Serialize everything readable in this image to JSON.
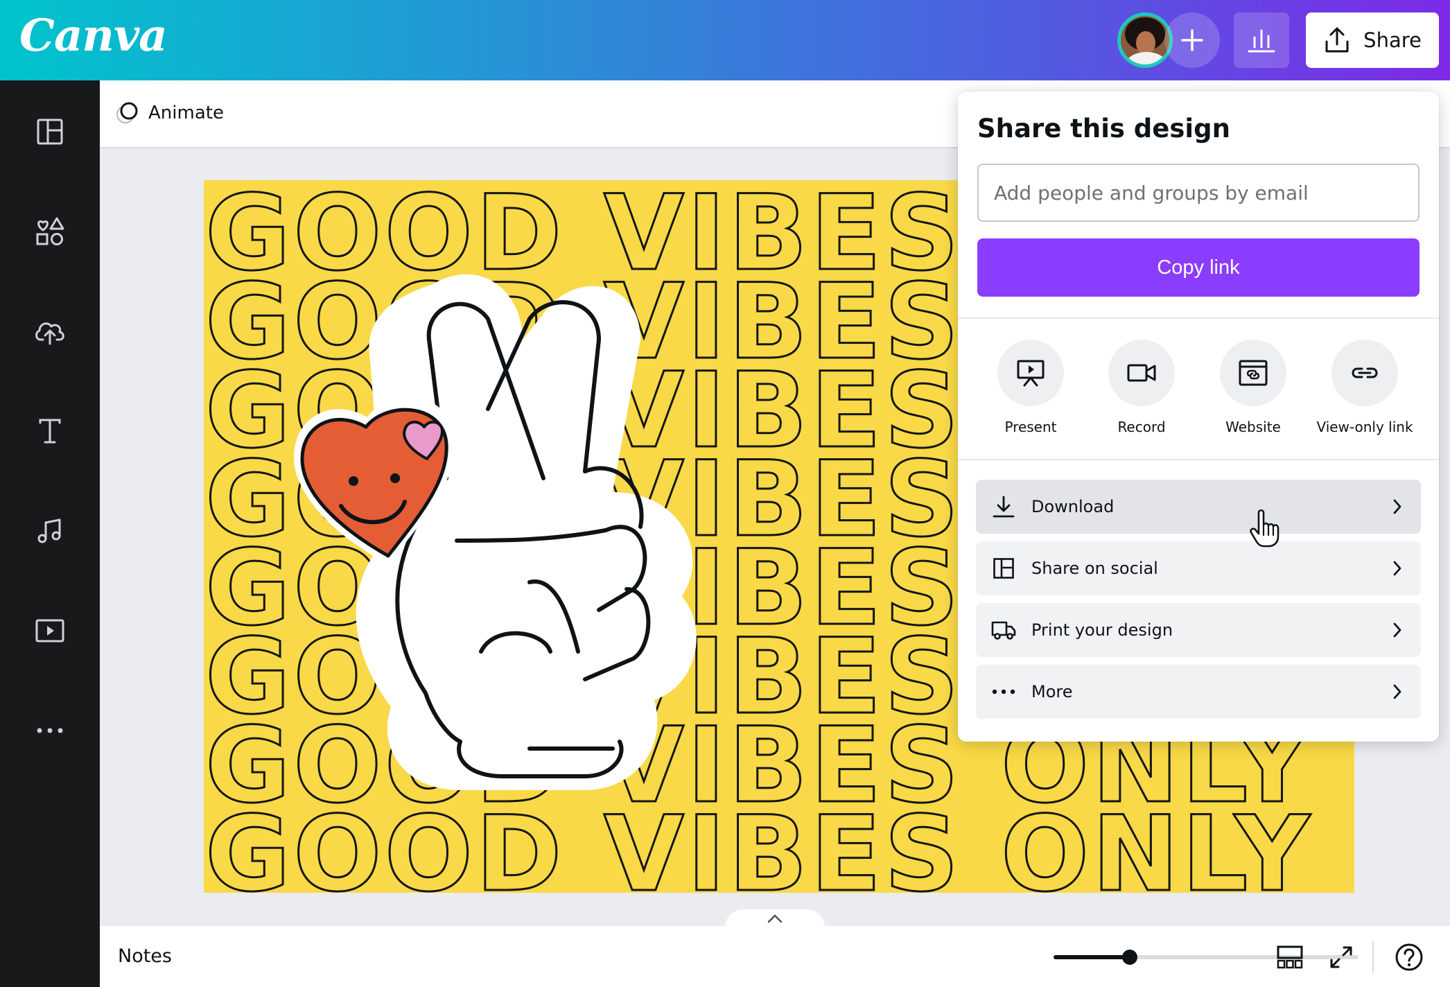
{
  "header": {
    "logo": "Canva",
    "share_label": "Share"
  },
  "toolbar": {
    "animate_label": "Animate"
  },
  "canvas": {
    "line1": "GOOD VIBES",
    "line2": "GOOD VIBES ONLY"
  },
  "share_panel": {
    "title": "Share this design",
    "email_placeholder": "Add people and groups by email",
    "copy_link_label": "Copy link",
    "quick_actions": [
      {
        "label": "Present",
        "icon": "present-icon"
      },
      {
        "label": "Record",
        "icon": "record-icon"
      },
      {
        "label": "Website",
        "icon": "website-icon"
      },
      {
        "label": "View-only link",
        "icon": "link-icon"
      }
    ],
    "options": [
      {
        "label": "Download",
        "icon": "download-icon"
      },
      {
        "label": "Share on social",
        "icon": "social-icon"
      },
      {
        "label": "Print your design",
        "icon": "truck-icon"
      },
      {
        "label": "More",
        "icon": "more-icon"
      }
    ]
  },
  "bottom_bar": {
    "notes_label": "Notes",
    "zoom_fraction": 0.25
  },
  "colors": {
    "brand_purple": "#8b3dff",
    "design_yellow": "#f9d947",
    "heart_red": "#e45d35",
    "heart_pink": "#e99acb",
    "rail_dark": "#18191b"
  }
}
